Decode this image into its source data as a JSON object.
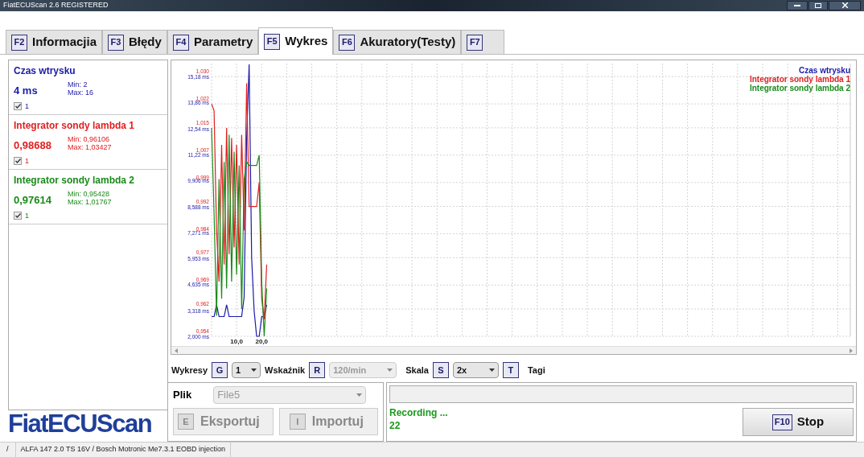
{
  "window": {
    "title": "FiatECUScan 2.6 REGISTERED"
  },
  "tabs": [
    {
      "key": "F2",
      "label": "Informacjia",
      "selected": false
    },
    {
      "key": "F3",
      "label": "Błędy",
      "selected": false
    },
    {
      "key": "F4",
      "label": "Parametry",
      "selected": false
    },
    {
      "key": "F5",
      "label": "Wykres",
      "selected": true
    },
    {
      "key": "F6",
      "label": "Akuratory(Testy)",
      "selected": false
    },
    {
      "key": "F7",
      "selected": false
    }
  ],
  "parameters": [
    {
      "name": "Czas wtrysku",
      "value": "4 ms",
      "min": "Min: 2",
      "max": "Max: 16",
      "color": "#1a1aa8",
      "checked": true,
      "check_label": "1"
    },
    {
      "name": "Integrator sondy lambda 1",
      "value": "0,98688",
      "min": "Min: 0,96106",
      "max": "Max: 1,03427",
      "color": "#e02020",
      "checked": true,
      "check_label": "1"
    },
    {
      "name": "Integrator sondy lambda 2",
      "value": "0,97614",
      "min": "Min: 0,95428",
      "max": "Max: 1,01767",
      "color": "#1a8a1a",
      "checked": true,
      "check_label": "1"
    }
  ],
  "chart": {
    "chart_data": {
      "type": "line",
      "grid": true,
      "xlim": [
        0,
        255
      ],
      "ylim": [
        0.954,
        1.0338
      ],
      "y2lim": [
        2.0,
        15.84
      ],
      "xticks": [
        {
          "value": 10,
          "label": "10,0"
        },
        {
          "value": 20,
          "label": "20,0"
        }
      ],
      "yticks": [
        {
          "value": 0.954,
          "label": "0,954"
        },
        {
          "value": 0.962,
          "label": "0,962"
        },
        {
          "value": 0.969,
          "label": "0,969"
        },
        {
          "value": 0.977,
          "label": "0,977"
        },
        {
          "value": 0.984,
          "label": "0,984"
        },
        {
          "value": 0.992,
          "label": "0,992"
        },
        {
          "value": 0.999,
          "label": "0,999"
        },
        {
          "value": 1.007,
          "label": "1,007"
        },
        {
          "value": 1.015,
          "label": "1,015"
        },
        {
          "value": 1.022,
          "label": "1,022"
        },
        {
          "value": 1.03,
          "label": "1,030"
        }
      ],
      "y2ticks": [
        {
          "value": 2.0,
          "label": "2,000 ms"
        },
        {
          "value": 3.318,
          "label": "3,318 ms"
        },
        {
          "value": 4.635,
          "label": "4,635 ms"
        },
        {
          "value": 5.953,
          "label": "5,953 ms"
        },
        {
          "value": 7.271,
          "label": "7,271 ms"
        },
        {
          "value": 8.588,
          "label": "8,588 ms"
        },
        {
          "value": 9.906,
          "label": "9,906 ms"
        },
        {
          "value": 11.22,
          "label": "11,22 ms"
        },
        {
          "value": 12.54,
          "label": "12,54 ms"
        },
        {
          "value": 13.86,
          "label": "13,86 ms"
        },
        {
          "value": 15.18,
          "label": "15,18 ms"
        }
      ],
      "x": [
        0,
        1,
        2,
        3,
        4,
        5,
        6,
        7,
        8,
        9,
        10,
        11,
        12,
        13,
        14,
        15,
        16,
        17,
        18,
        19,
        20,
        21,
        22
      ],
      "series": [
        {
          "name": "Czas wtrysku",
          "color": "#1a1aa8",
          "axis": "y2",
          "values": [
            3.0,
            3.0,
            3.6,
            3.0,
            3.0,
            3.0,
            3.6,
            3.0,
            3.0,
            3.0,
            3.0,
            3.0,
            3.0,
            4.0,
            12.0,
            15.8,
            6.0,
            3.3,
            2.0,
            2.0,
            3.0,
            3.0,
            3.6
          ]
        },
        {
          "name": "Integrator sondy lambda 1",
          "color": "#e02020",
          "axis": "y",
          "values": [
            1.022,
            1.02,
            0.985,
            0.97,
            1.01,
            0.975,
            1.015,
            0.978,
            1.012,
            0.98,
            1.01,
            0.975,
            1.013,
            0.985,
            1.028,
            0.992,
            0.992,
            0.992,
            0.992,
            0.999,
            0.965,
            0.959,
            0.975
          ]
        },
        {
          "name": "Integrator sondy lambda 2",
          "color": "#1a8a1a",
          "axis": "y",
          "values": [
            1.015,
            0.99,
            0.96,
            1.0,
            0.965,
            1.005,
            0.968,
            1.013,
            0.97,
            1.008,
            0.972,
            1.004,
            0.962,
            1.0,
            1.005,
            1.004,
            1.004,
            1.004,
            1.004,
            1.007,
            0.97,
            0.954,
            0.968
          ]
        }
      ]
    }
  },
  "controls": {
    "charts_label": "Wykresy",
    "charts_key": "G",
    "charts_value": "1",
    "indicator_label": "Wskaźnik",
    "indicator_key": "R",
    "indicator_value": "120/min",
    "indicator_disabled": true,
    "scale_label": "Skala",
    "scale_key": "S",
    "scale_value": "2x",
    "tags_key": "T",
    "tags_label": "Tagi"
  },
  "file": {
    "label": "Plik",
    "value": "File5",
    "disabled": true,
    "export_key": "E",
    "export_label": "Eksportuj",
    "import_key": "I",
    "import_label": "Importuj"
  },
  "recording": {
    "level": 0,
    "status": "Recording ...",
    "count": "22",
    "stop_key": "F10",
    "stop_label": "Stop"
  },
  "logo": "FiatECUScan",
  "status_bar": [
    "/",
    "ALFA 147 2.0 TS 16V / Bosch Motronic Me7.3.1 EOBD injection"
  ]
}
